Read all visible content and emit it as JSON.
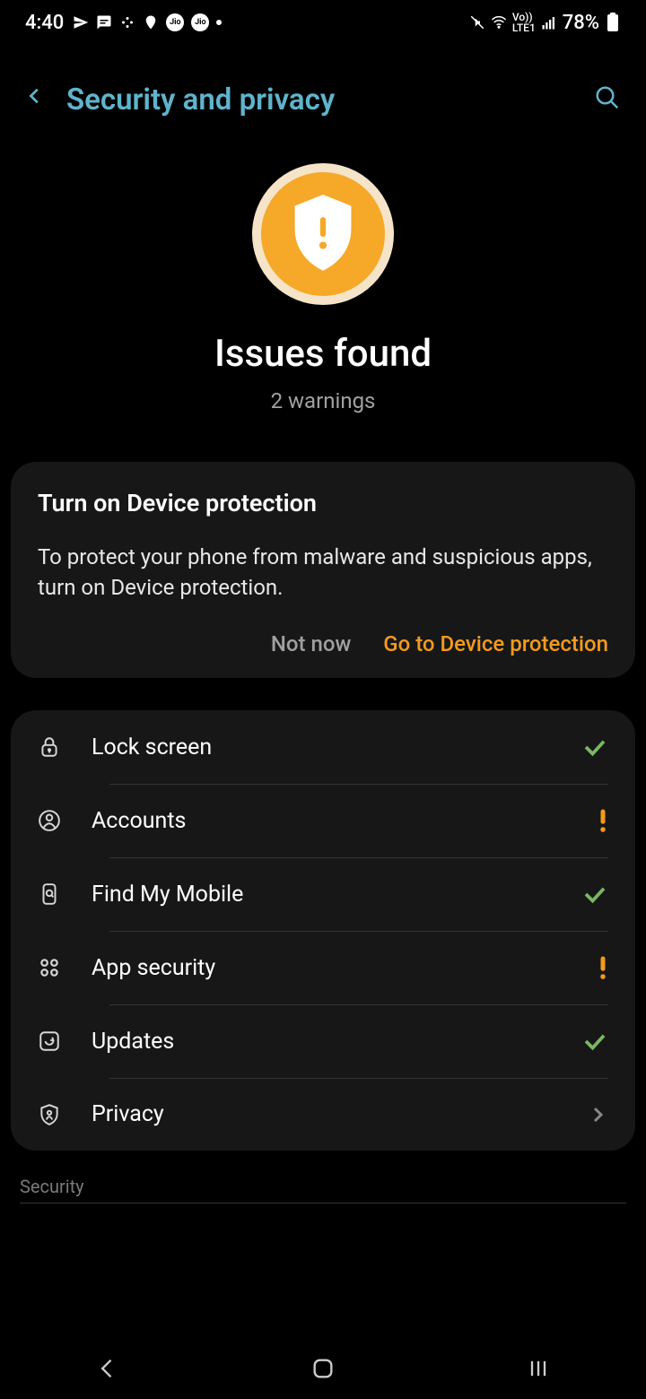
{
  "status_bar": {
    "time": "4:40",
    "battery": "78%",
    "network": "LTE1",
    "vo": "Vo))"
  },
  "header": {
    "title": "Security and privacy"
  },
  "hero": {
    "title": "Issues found",
    "subtitle": "2 warnings"
  },
  "card": {
    "title": "Turn on Device protection",
    "description": "To protect your phone from malware and suspicious apps, turn on Device protection.",
    "not_now": "Not now",
    "go": "Go to Device protection"
  },
  "list": {
    "items": [
      {
        "label": "Lock screen",
        "status": "check"
      },
      {
        "label": "Accounts",
        "status": "warn"
      },
      {
        "label": "Find My Mobile",
        "status": "check"
      },
      {
        "label": "App security",
        "status": "warn"
      },
      {
        "label": "Updates",
        "status": "check"
      },
      {
        "label": "Privacy",
        "status": "chevron"
      }
    ]
  },
  "section": {
    "security": "Security"
  }
}
